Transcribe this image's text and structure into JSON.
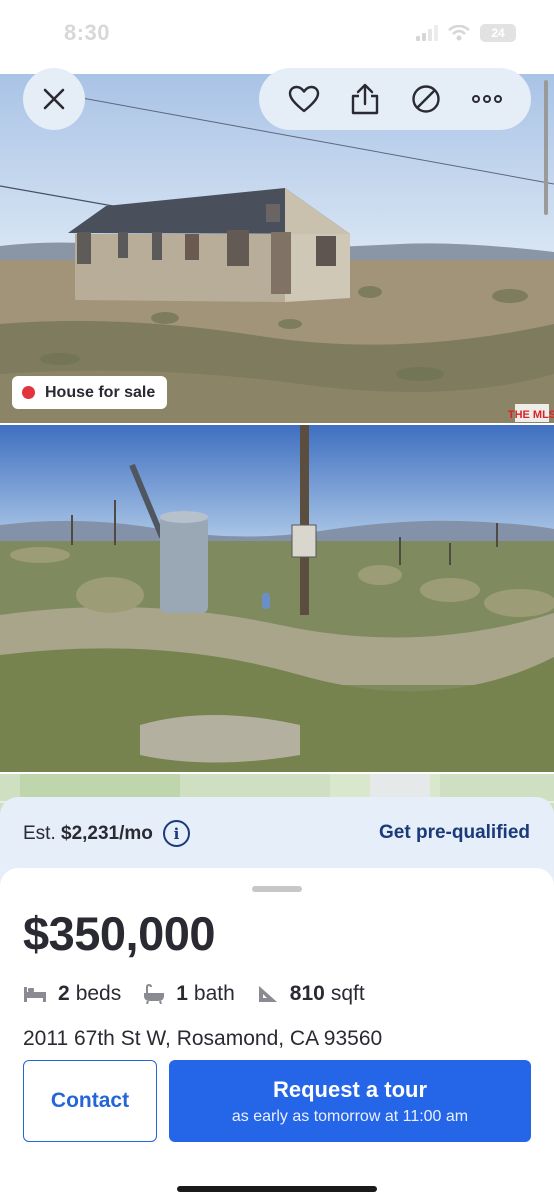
{
  "status_bar": {
    "time": "8:30",
    "battery": "24"
  },
  "listing": {
    "badge": "House for sale",
    "mls_logo": "THE MLS",
    "price": "$350,000",
    "beds_value": "2",
    "beds_label": "beds",
    "baths_value": "1",
    "baths_label": "bath",
    "sqft_value": "810",
    "sqft_label": "sqft",
    "address": "2011 67th St W, Rosamond, CA 93560"
  },
  "estimate": {
    "prefix": "Est.",
    "amount": "$2,231/mo",
    "prequal_label": "Get pre-qualified"
  },
  "actions": {
    "contact_label": "Contact",
    "tour_title": "Request a tour",
    "tour_subtitle": "as early as tomorrow at 11:00 am"
  },
  "icons": {
    "close": "close-icon",
    "save": "heart-icon",
    "share": "share-icon",
    "hide": "hide-icon",
    "more": "more-icon",
    "info": "info-icon",
    "beds": "bed-icon",
    "baths": "bath-icon",
    "sqft": "ruler-icon"
  },
  "colors": {
    "brand_blue": "#2566e8",
    "link_navy": "#1b3a79",
    "for_sale_dot": "#e2333f",
    "estimate_bg": "#e5eef9"
  }
}
